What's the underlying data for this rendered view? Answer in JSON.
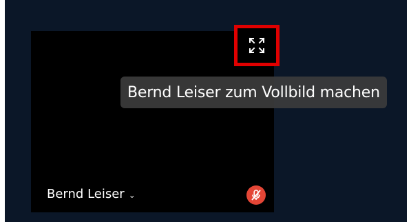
{
  "tile": {
    "participant_name": "Bernd Leiser",
    "name_menu_icon": "chevron-down-icon",
    "mic_status_icon": "muted-mic-icon",
    "mic_status_color": "#e44636"
  },
  "fullscreen": {
    "icon": "expand-arrows-icon",
    "highlight_color": "#e00000",
    "tooltip": "Bernd Leiser zum Vollbild machen"
  },
  "colors": {
    "background": "#0b1728",
    "tile": "#000000",
    "tooltip_bg": "#3c3c3c"
  }
}
